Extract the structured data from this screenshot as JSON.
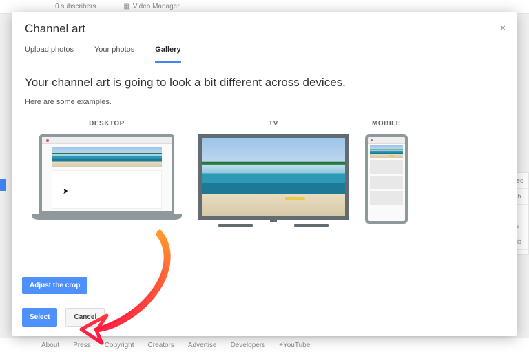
{
  "background": {
    "subscribers": "0 subscribers",
    "video_manager": "Video Manager",
    "footer_links": [
      "About",
      "Press",
      "Copyright",
      "Creators",
      "Advertise",
      "Developers",
      "+YouTube"
    ],
    "side_fragments": [
      "rec",
      "ch",
      "ar",
      "ub"
    ]
  },
  "modal": {
    "title": "Channel art",
    "close_label": "×",
    "tabs": {
      "upload": "Upload photos",
      "your": "Your photos",
      "gallery": "Gallery"
    },
    "headline": "Your channel art is going to look a bit different across devices.",
    "subtext": "Here are some examples.",
    "preview_labels": {
      "desktop": "DESKTOP",
      "tv": "TV",
      "mobile": "MOBILE"
    },
    "buttons": {
      "adjust": "Adjust the crop",
      "select": "Select",
      "cancel": "Cancel"
    }
  }
}
